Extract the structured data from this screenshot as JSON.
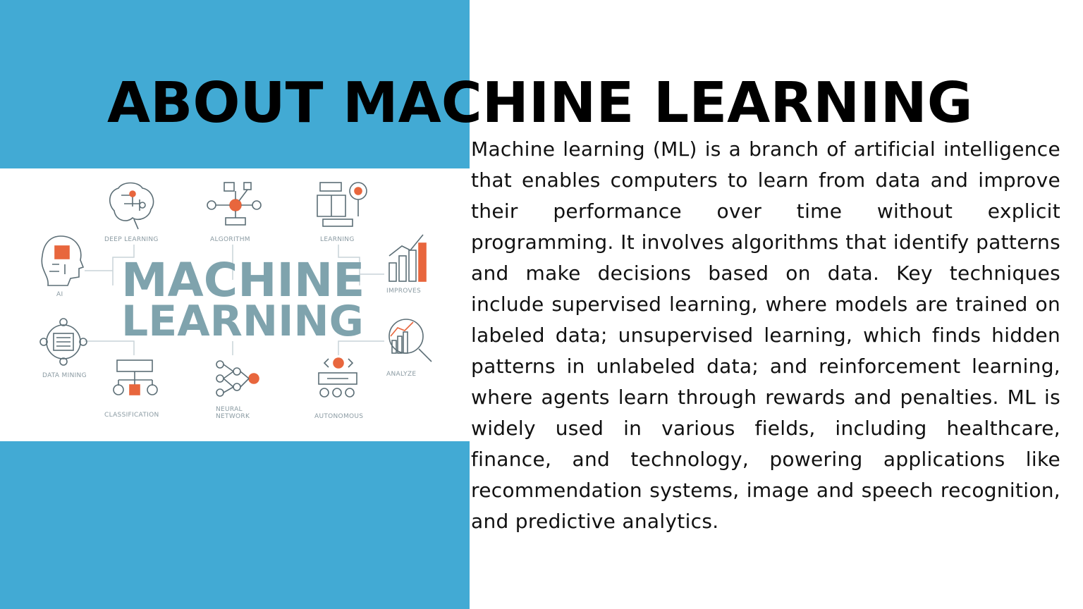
{
  "slide": {
    "title": "ABOUT MACHINE LEARNING",
    "body": "Machine learning (ML) is a branch of artificial intelligence that enables computers to learn from data and improve their performance over time without explicit programming. It involves algorithms that identify patterns and make decisions based on data. Key techniques include supervised learning, where models are trained on labeled data; unsupervised learning, which finds hidden patterns in unlabeled data; and reinforcement learning, where agents learn through rewards and penalties. ML is widely used in various fields, including healthcare, finance, and technology, powering applications like recommendation systems, image and speech recognition, and predictive analytics."
  },
  "illustration": {
    "line1": "MACHINE",
    "line2": "LEARNING",
    "labels": {
      "deep_learning": "DEEP LEARNING",
      "algorithm": "ALGORITHM",
      "learning": "LEARNING",
      "ai": "AI",
      "improves": "IMPROVES",
      "data_mining": "DATA MINING",
      "analyze": "ANALYZE",
      "classification": "CLASSIFICATION",
      "neural_network_1": "NEURAL",
      "neural_network_2": "NETWORK",
      "autonomous": "AUTONOMOUS"
    },
    "icons": [
      "brain-icon",
      "algorithm-icon",
      "book-gear-icon",
      "ai-head-icon",
      "bar-chart-icon",
      "data-mining-icon",
      "analyze-magnifier-icon",
      "classification-icon",
      "neural-network-icon",
      "autonomous-icon"
    ]
  },
  "colors": {
    "panel_blue": "#42aad4",
    "illustration_text": "#7fa3ad",
    "accent_orange": "#e8663d",
    "icon_stroke": "#5c6e76"
  }
}
